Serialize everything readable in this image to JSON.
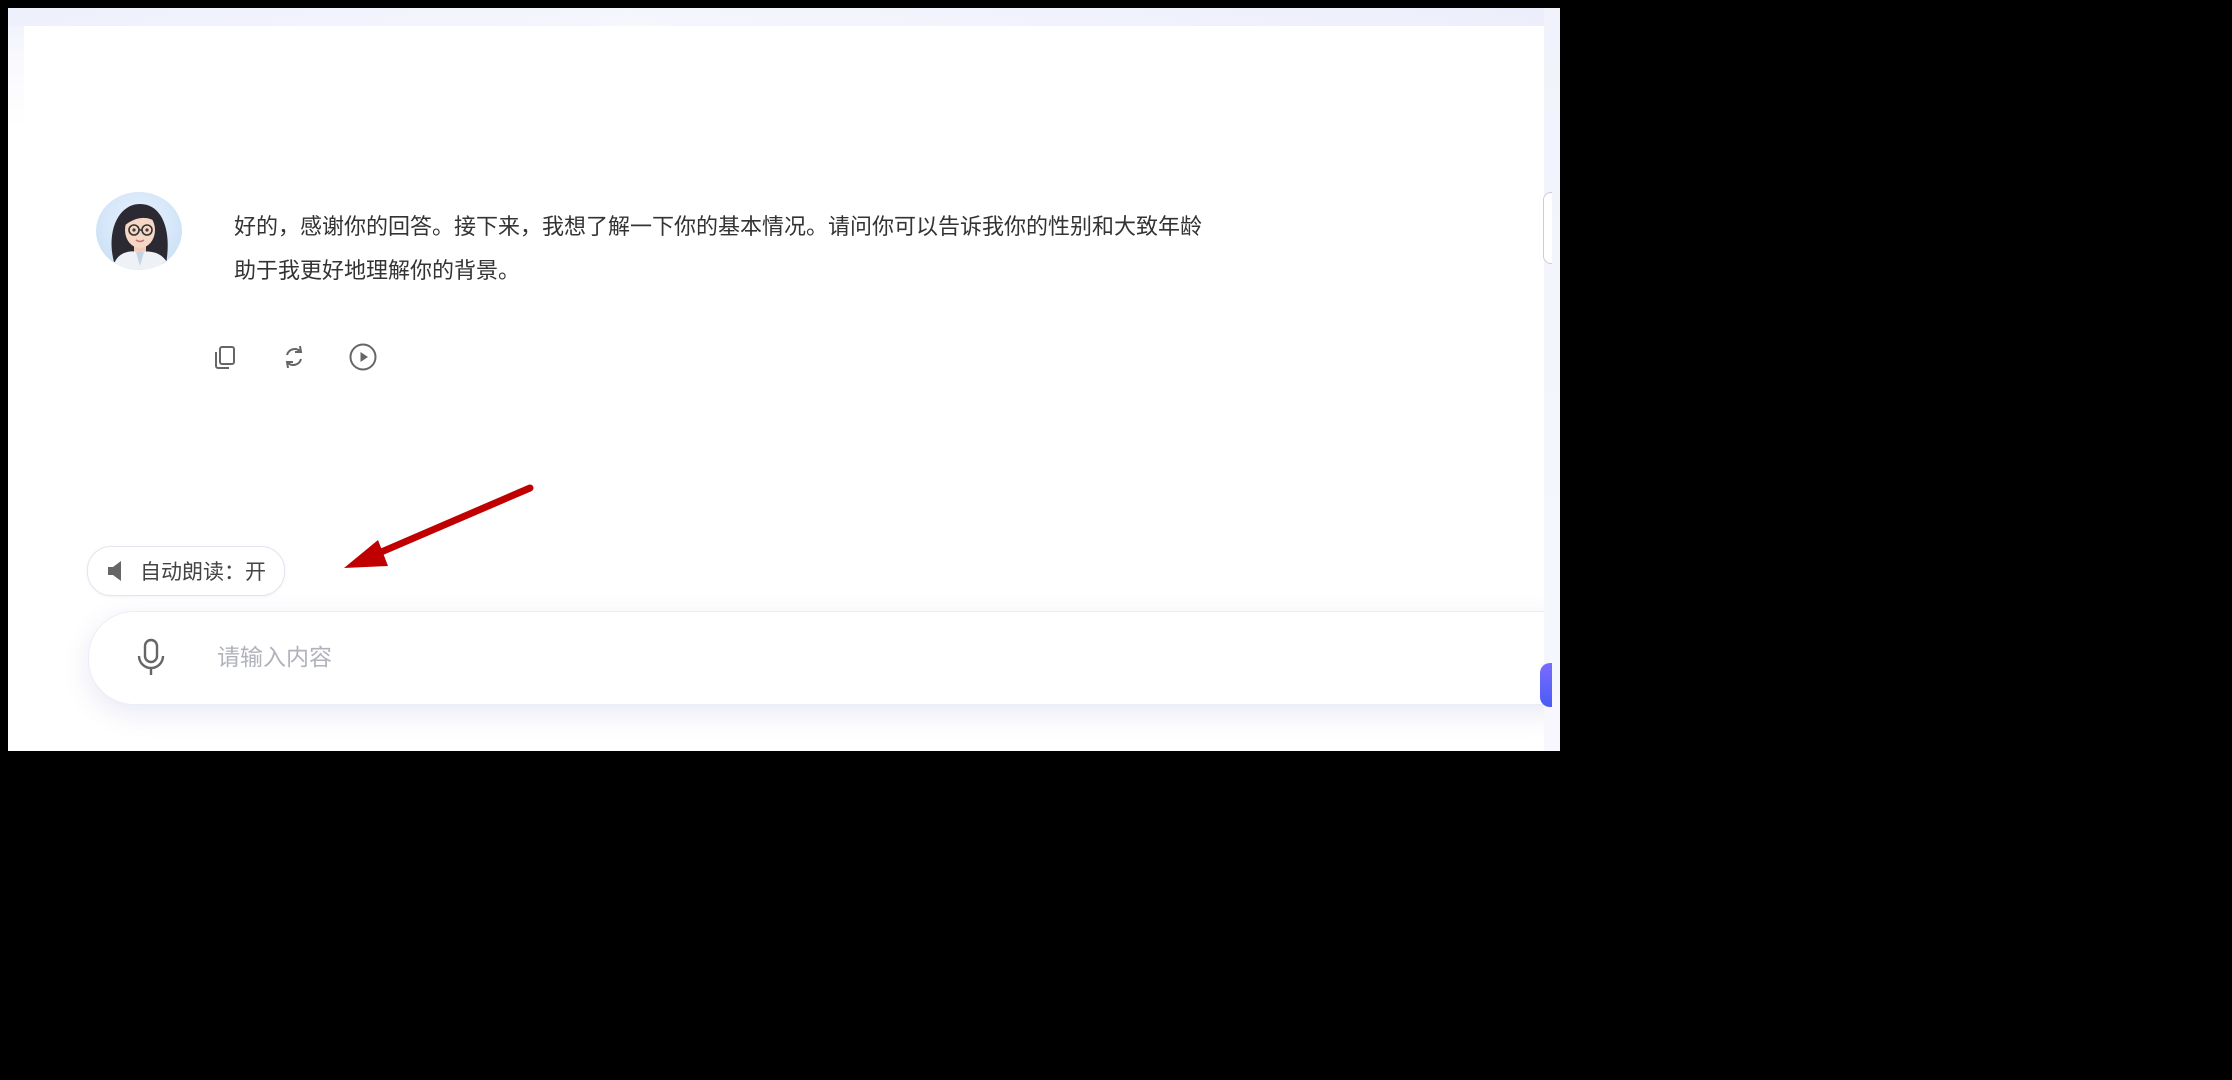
{
  "chat": {
    "assistant_message": {
      "line1": "好的，感谢你的回答。接下来，我想了解一下你的基本情况。请问你可以告诉我你的性别和大致年龄",
      "line2": "助于我更好地理解你的背景。"
    },
    "actions": [
      {
        "icon": "copy-icon"
      },
      {
        "icon": "refresh-icon"
      },
      {
        "icon": "play-icon"
      }
    ]
  },
  "auto_read": {
    "icon": "speaker-icon",
    "label": "自动朗读：开"
  },
  "input": {
    "placeholder": "请输入内容",
    "value": "",
    "mic_icon": "microphone-icon"
  },
  "colors": {
    "annotation_arrow": "#c00000",
    "send_accent": "#5b5cf6",
    "text": "#333333",
    "placeholder": "#b1b3bc"
  }
}
